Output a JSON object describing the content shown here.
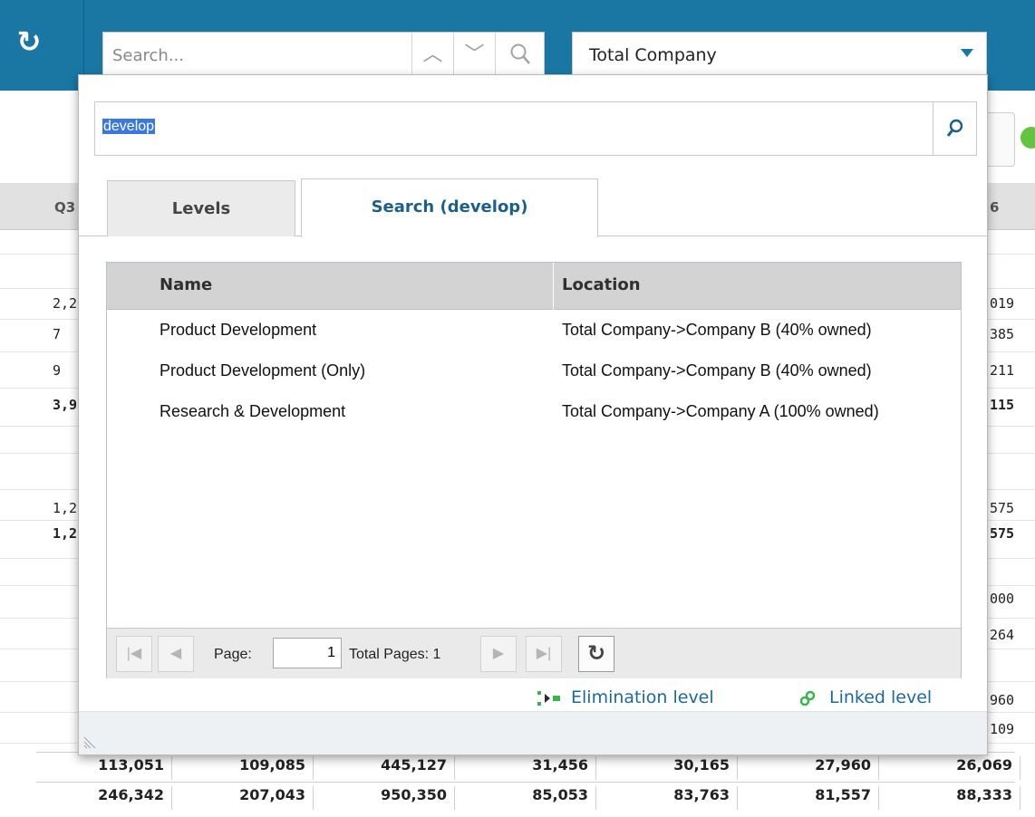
{
  "topbar": {
    "search_placeholder": "Search...",
    "scope_value": "Total Company"
  },
  "background_grid": {
    "header_left": "Q3",
    "header_right": "6",
    "left_fragments": [
      {
        "text": "2,2",
        "bold": false
      },
      {
        "text": "7",
        "bold": false
      },
      {
        "text": "9",
        "bold": false
      },
      {
        "text": "3,9",
        "bold": true
      },
      {
        "text": "1,2",
        "bold": false
      },
      {
        "text": "1,2",
        "bold": true
      }
    ],
    "right_fragments": [
      {
        "text": "019",
        "bold": false
      },
      {
        "text": "385",
        "bold": false
      },
      {
        "text": "211",
        "bold": false
      },
      {
        "text": "115",
        "bold": true
      },
      {
        "text": "575",
        "bold": false
      },
      {
        "text": "575",
        "bold": true
      },
      {
        "text": "000",
        "bold": false
      },
      {
        "text": "264",
        "bold": false
      },
      {
        "text": "960",
        "bold": false
      },
      {
        "text": "109",
        "bold": false
      }
    ],
    "bottom_rows": [
      [
        "113,051",
        "109,085",
        "445,127",
        "31,456",
        "30,165",
        "27,960",
        "26,069"
      ],
      [
        "246,342",
        "207,043",
        "950,350",
        "85,053",
        "83,763",
        "81,557",
        "88,333"
      ]
    ]
  },
  "popup": {
    "search_value": "develop",
    "tabs": [
      {
        "label": "Levels",
        "active": false
      },
      {
        "label": "Search (develop)",
        "active": true
      }
    ],
    "columns": {
      "name": "Name",
      "location": "Location"
    },
    "results": [
      {
        "name": "Product Development",
        "location": "Total Company->Company B (40% owned)"
      },
      {
        "name": "Product Development (Only)",
        "location": "Total Company->Company B (40% owned)"
      },
      {
        "name": "Research & Development",
        "location": "Total Company->Company A (100% owned)"
      }
    ],
    "pager": {
      "page_label": "Page:",
      "page_value": "1",
      "total_pages_label": "Total Pages: 1"
    },
    "legend": {
      "elimination": "Elimination level",
      "linked": "Linked level"
    }
  },
  "colors": {
    "topbar": "#1a77a4",
    "accent_text": "#1d6a9a",
    "selection": "#3b78d8"
  }
}
